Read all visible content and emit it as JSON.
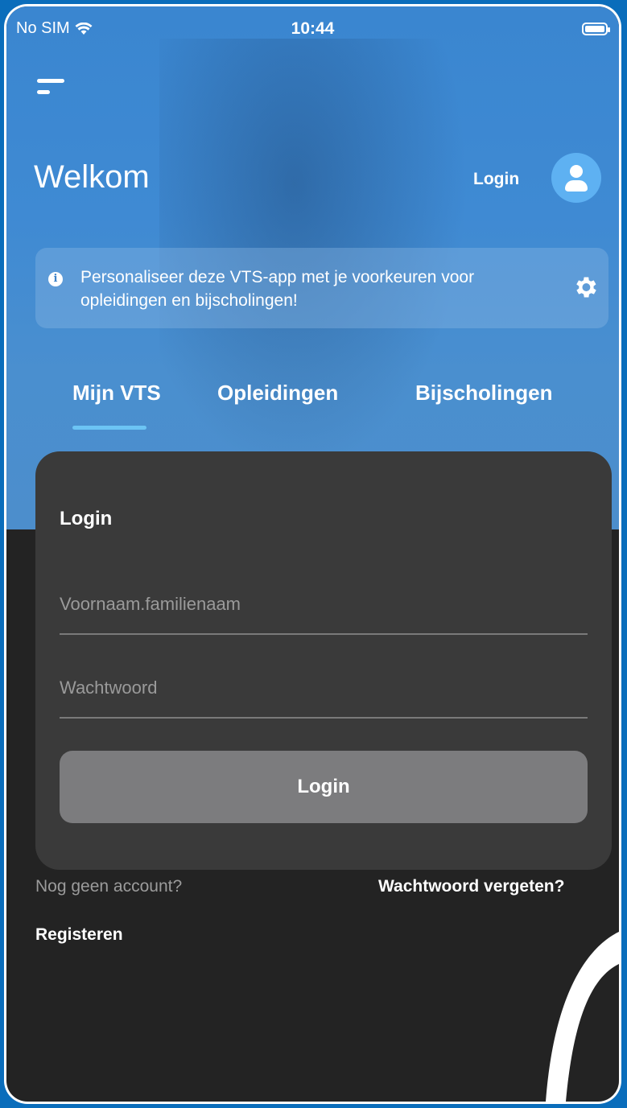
{
  "status_bar": {
    "carrier": "No SIM",
    "time": "10:44"
  },
  "header": {
    "welcome": "Welkom",
    "login_label": "Login"
  },
  "info_banner": {
    "text": "Personaliseer deze VTS-app met je voorkeuren voor opleidingen en bijscholingen!",
    "icon": "i"
  },
  "tabs": [
    {
      "label": "Mijn VTS",
      "active": true
    },
    {
      "label": "Opleidingen",
      "active": false
    },
    {
      "label": "Bijscholingen",
      "active": false
    }
  ],
  "login_card": {
    "title": "Login",
    "username_placeholder": "Voornaam.familienaam",
    "password_placeholder": "Wachtwoord",
    "submit_label": "Login"
  },
  "footer": {
    "no_account": "Nog geen account?",
    "forgot_password": "Wachtwoord vergeten?",
    "register": "Registeren"
  },
  "colors": {
    "hero_blue": "#3f8ad3",
    "accent": "#6cc4f4",
    "avatar_bg": "#5eb1f2",
    "card_bg": "#3a3a3a",
    "page_bg": "#232323",
    "button_bg": "#7c7c7e"
  }
}
